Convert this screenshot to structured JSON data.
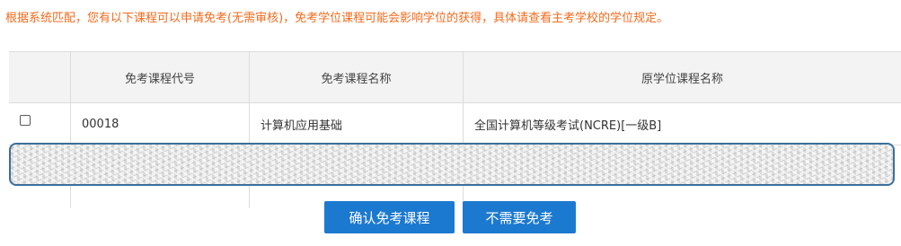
{
  "notice": "根据系统匹配，您有以下课程可以申请免考(无需审核)，免考学位课程可能会影响学位的获得，具体请查看主考学校的学位规定。",
  "table": {
    "headers": [
      "",
      "免考课程代号",
      "免考课程名称",
      "原学位课程名称"
    ],
    "rows": [
      {
        "checked": false,
        "code": "00018",
        "name": "计算机应用基础",
        "original": "全国计算机等级考试(NCRE)[一级B]"
      }
    ]
  },
  "buttons": {
    "confirm": "确认免考课程",
    "skip": "不需要免考"
  },
  "colors": {
    "notice": "#f26a1b",
    "button": "#1c79d0",
    "header_bg": "#f3f3f3",
    "redaction_border": "#3c6f9a"
  }
}
